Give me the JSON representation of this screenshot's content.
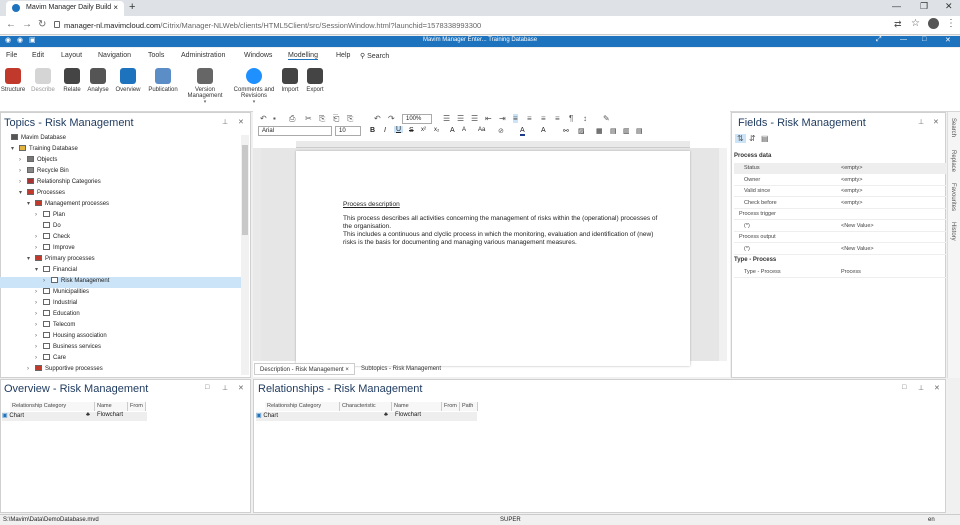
{
  "browser": {
    "tab_title": "Mavim Manager Daily Build",
    "url_host": "manager-nl.mavimcloud.com",
    "url_path": "/Citrix/Manager-NLWeb/clients/HTML5Client/src/SessionWindow.html?launchid=1578338993300"
  },
  "app": {
    "title": "Mavim Manager Enter...   Training Database"
  },
  "menu": [
    "File",
    "Edit",
    "Layout",
    "Navigation",
    "Tools",
    "Administration",
    "Windows",
    "Modelling",
    "Help",
    "Search"
  ],
  "ribbon": [
    {
      "label": "Structure",
      "sub": "",
      "icon": "structure-icon",
      "color": "#c0392b"
    },
    {
      "label": "Describe",
      "sub": "",
      "icon": "describe-icon",
      "color": "#bbbbbb"
    },
    {
      "label": "Relate",
      "sub": "",
      "icon": "relate-icon",
      "color": "#444444"
    },
    {
      "label": "Analyse",
      "sub": "",
      "icon": "analyse-icon",
      "color": "#555555"
    },
    {
      "label": "Overview",
      "sub": "",
      "icon": "overview-icon",
      "color": "#1e73be"
    },
    {
      "label": "Publication",
      "sub": "",
      "icon": "publication-icon",
      "color": "#5b8ec7"
    },
    {
      "label": "Version Management",
      "sub": "▾",
      "icon": "version-icon",
      "color": "#666666"
    },
    {
      "label": "Comments and Revisions",
      "sub": "▾",
      "icon": "info-icon",
      "color": "#1e90ff"
    },
    {
      "label": "Import",
      "sub": "",
      "icon": "import-icon",
      "color": "#444444"
    },
    {
      "label": "Export",
      "sub": "",
      "icon": "export-icon",
      "color": "#444444"
    }
  ],
  "topics": {
    "title": "Topics - Risk Management",
    "tree": [
      {
        "label": "Mavim Database",
        "indent": 0,
        "arrow": "",
        "icon": "database-icon"
      },
      {
        "label": "Training Database",
        "indent": 1,
        "arrow": "▾",
        "icon": "folder-icon"
      },
      {
        "label": "Objects",
        "indent": 2,
        "arrow": "›",
        "icon": "objects-icon"
      },
      {
        "label": "Recycle Bin",
        "indent": 2,
        "arrow": "›",
        "icon": "recycle-bin-icon"
      },
      {
        "label": "Relationship Categories",
        "indent": 2,
        "arrow": "›",
        "icon": "relationship-icon"
      },
      {
        "label": "Processes",
        "indent": 2,
        "arrow": "▾",
        "icon": "processes-icon"
      },
      {
        "label": "Management processes",
        "indent": 3,
        "arrow": "▾",
        "icon": "processes-icon"
      },
      {
        "label": "Plan",
        "indent": 4,
        "arrow": "›",
        "icon": "process-icon"
      },
      {
        "label": "Do",
        "indent": 4,
        "arrow": "",
        "icon": "process-icon"
      },
      {
        "label": "Check",
        "indent": 4,
        "arrow": "›",
        "icon": "process-icon"
      },
      {
        "label": "Improve",
        "indent": 4,
        "arrow": "›",
        "icon": "process-icon"
      },
      {
        "label": "Primary processes",
        "indent": 3,
        "arrow": "▾",
        "icon": "processes-icon"
      },
      {
        "label": "Financial",
        "indent": 4,
        "arrow": "▾",
        "icon": "process-icon"
      },
      {
        "label": "Risk Management",
        "indent": 5,
        "arrow": "›",
        "icon": "process-icon",
        "selected": true
      },
      {
        "label": "Municipalities",
        "indent": 4,
        "arrow": "›",
        "icon": "process-icon"
      },
      {
        "label": "Industrial",
        "indent": 4,
        "arrow": "›",
        "icon": "process-icon"
      },
      {
        "label": "Education",
        "indent": 4,
        "arrow": "›",
        "icon": "process-icon"
      },
      {
        "label": "Telecom",
        "indent": 4,
        "arrow": "›",
        "icon": "process-icon"
      },
      {
        "label": "Housing association",
        "indent": 4,
        "arrow": "›",
        "icon": "process-icon"
      },
      {
        "label": "Business services",
        "indent": 4,
        "arrow": "›",
        "icon": "process-icon"
      },
      {
        "label": "Care",
        "indent": 4,
        "arrow": "›",
        "icon": "process-icon"
      },
      {
        "label": "Supportive processes",
        "indent": 3,
        "arrow": "›",
        "icon": "processes-icon"
      }
    ]
  },
  "editor": {
    "font": "Arial",
    "size": "10",
    "zoom": "100%",
    "heading": "Process description",
    "paragraphs": [
      "This process describes all activities concerning the management of risks within the (operational) processes of the organisation.",
      "This includes a continuous and clyclic process in which the monitoring, evaluation and identification of (new) risks is the basis for documenting and managing various management measures."
    ],
    "tabs": [
      "Description - Risk Management",
      "Subtopics - Risk Management"
    ]
  },
  "fields": {
    "title": "Fields - Risk Management",
    "section1": "Process data",
    "rows": [
      {
        "label": "Status",
        "value": "<empty>"
      },
      {
        "label": "Owner",
        "value": "<empty>"
      },
      {
        "label": "Valid since",
        "value": "<empty>"
      },
      {
        "label": "Check before",
        "value": "<empty>"
      },
      {
        "label": "Process trigger",
        "value": ""
      },
      {
        "label": "(*)",
        "value": "<New Value>"
      },
      {
        "label": "Process output",
        "value": ""
      },
      {
        "label": "(*)",
        "value": "<New Value>"
      }
    ],
    "section2": "Type - Process",
    "type_row": {
      "label": "Type - Process",
      "value": "Process"
    }
  },
  "side_tabs": [
    "Search",
    "Replace",
    "Favourites",
    "History"
  ],
  "overview": {
    "title": "Overview - Risk Management",
    "columns": [
      "Relationship Category",
      "Name",
      "From"
    ],
    "row": {
      "category": "Chart",
      "name": "Flowchart"
    }
  },
  "relationships": {
    "title": "Relationships - Risk Management",
    "columns": [
      "Relationship Category",
      "Characteristic",
      "Name",
      "From",
      "Path"
    ],
    "row": {
      "category": "Chart",
      "name": "Flowchart"
    }
  },
  "status": {
    "path": "S:\\Mavim\\Data\\DemoDatabase.mvd",
    "user": "SUPER",
    "lang": "en"
  }
}
